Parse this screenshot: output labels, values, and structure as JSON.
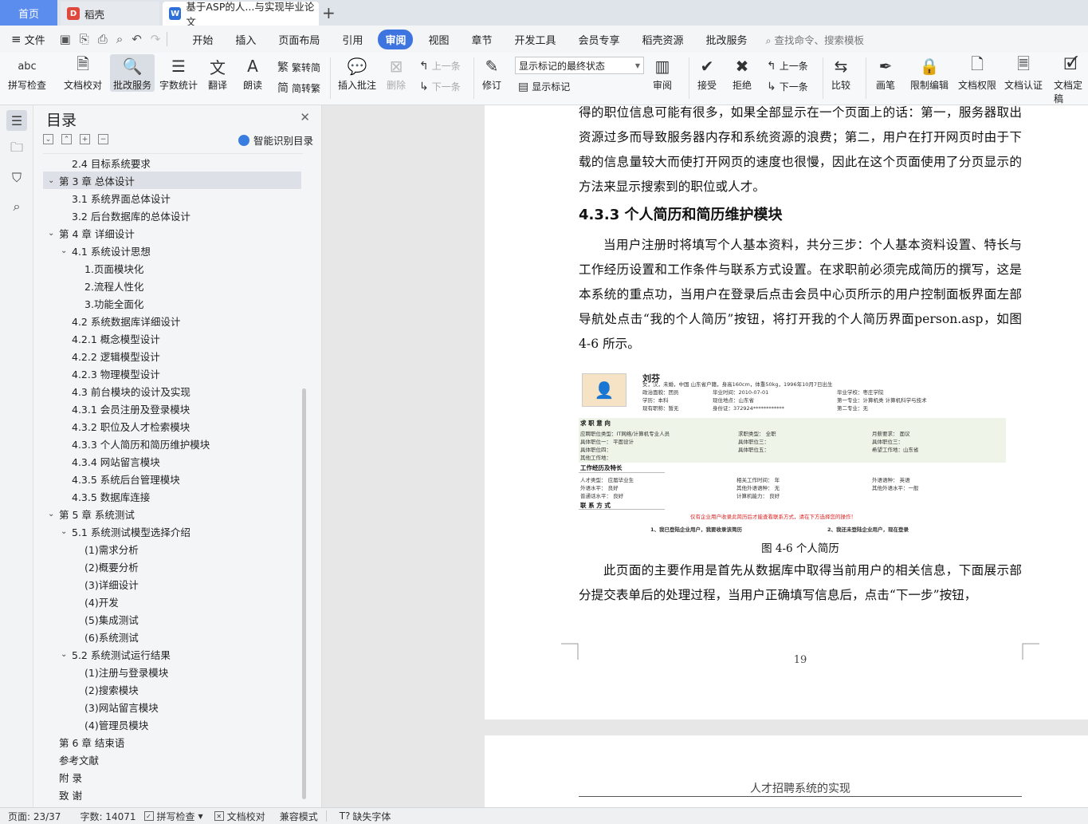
{
  "tabs": {
    "home": "首页",
    "tab1": "稻壳",
    "tab2": "基于ASP的人...与实现毕业论文"
  },
  "menu": {
    "file": "文件",
    "items": [
      "开始",
      "插入",
      "页面布局",
      "引用",
      "审阅",
      "视图",
      "章节",
      "开发工具",
      "会员专享",
      "稻壳资源",
      "批改服务"
    ],
    "active": "审阅",
    "search": "查找命令、搜索模板"
  },
  "ribbon": {
    "spell_check": "拼写检查",
    "doc_check": "文档校对",
    "review_service": "批改服务",
    "word_count": "字数统计",
    "translate": "翻译",
    "read_aloud": "朗读",
    "trad_to_simp": "繁转简",
    "simp_to_trad": "简转繁",
    "insert_comment": "插入批注",
    "delete": "删除",
    "prev": "上一条",
    "next": "下一条",
    "revise": "修订",
    "markup_select": "显示标记的最终状态",
    "show_markup": "显示标记",
    "review": "审阅",
    "accept": "接受",
    "reject": "拒绝",
    "prev2": "上一条",
    "next2": "下一条",
    "compare": "比较",
    "pen": "画笔",
    "restrict_edit": "限制编辑",
    "doc_permission": "文档权限",
    "doc_auth": "文档认证",
    "doc_final": "文档定稿"
  },
  "toc": {
    "title": "目录",
    "smart": "智能识别目录",
    "items": [
      {
        "text": "2.4 目标系统要求",
        "level": 2
      },
      {
        "text": "第 3 章  总体设计",
        "level": 1,
        "open": true,
        "selected": true
      },
      {
        "text": "3.1 系统界面总体设计",
        "level": 2
      },
      {
        "text": "3.2  后台数据库的总体设计",
        "level": 2
      },
      {
        "text": "第 4 章  详细设计",
        "level": 1,
        "open": true
      },
      {
        "text": "4.1 系统设计思想",
        "level": 2,
        "open": true
      },
      {
        "text": "1.页面模块化",
        "level": 3
      },
      {
        "text": "2.流程人性化",
        "level": 3
      },
      {
        "text": "3.功能全面化",
        "level": 3
      },
      {
        "text": "4.2 系统数据库详细设计",
        "level": 2
      },
      {
        "text": "4.2.1 概念模型设计",
        "level": 2
      },
      {
        "text": "4.2.2 逻辑模型设计",
        "level": 2
      },
      {
        "text": "4.2.3 物理模型设计",
        "level": 2
      },
      {
        "text": "4.3 前台模块的设计及实现",
        "level": 2
      },
      {
        "text": "4.3.1 会员注册及登录模块",
        "level": 2
      },
      {
        "text": "4.3.2 职位及人才检索模块",
        "level": 2
      },
      {
        "text": "4.3.3 个人简历和简历维护模块",
        "level": 2
      },
      {
        "text": "4.3.4 网站留言模块",
        "level": 2
      },
      {
        "text": "4.3.5 系统后台管理模块",
        "level": 2
      },
      {
        "text": "4.3.5 数据库连接",
        "level": 2
      },
      {
        "text": "第 5 章  系统测试",
        "level": 1,
        "open": true
      },
      {
        "text": "5.1 系统测试模型选择介绍",
        "level": 2,
        "open": true
      },
      {
        "text": "(1)需求分析",
        "level": 3
      },
      {
        "text": "(2)概要分析",
        "level": 3
      },
      {
        "text": "(3)详细设计",
        "level": 3
      },
      {
        "text": "(4)开发",
        "level": 3
      },
      {
        "text": "(5)集成测试",
        "level": 3
      },
      {
        "text": "(6)系统测试",
        "level": 3
      },
      {
        "text": "5.2 系统测试运行结果",
        "level": 2,
        "open": true
      },
      {
        "text": "(1)注册与登录模块",
        "level": 3
      },
      {
        "text": "(2)搜索模块",
        "level": 3
      },
      {
        "text": "(3)网站留言模块",
        "level": 3
      },
      {
        "text": "(4)管理员模块",
        "level": 3
      },
      {
        "text": "第 6 章 结束语",
        "level": 1
      },
      {
        "text": "参考文献",
        "level": 1
      },
      {
        "text": "附  录",
        "level": 1
      },
      {
        "text": "致  谢",
        "level": 1
      }
    ]
  },
  "document": {
    "para1": "得的职位信息可能有很多，如果全部显示在一个页面上的话：第一，服务器取出资源过多而导致服务器内存和系统资源的浪费；第二，用户在打开网页时由于下载的信息量较大而使打开网页的速度也很慢，因此在这个页面使用了分页显示的方法来显示搜索到的职位或人才。",
    "heading": "4.3.3 个人简历和简历维护模块",
    "para2": "当用户注册时将填写个人基本资料，共分三步：个人基本资料设置、特长与工作经历设置和工作条件与联系方式设置。在求职前必须完成简历的撰写，这是本系统的重点功，当用户在登录后点击会员中心页所示的用户控制面板界面左部导航处点击“我的个人简历”按钮，将打开我的个人简历界面person.asp，如图 4-6 所示。",
    "caption": "图 4-6 个人简历",
    "para3": "此页面的主要作用是首先从数据库中取得当前用户的相关信息，下面展示部分提交表单后的处理过程，当用户正确填写信息后，点击“下一步”按钮，",
    "page_number": "19",
    "page2_header": "人才招聘系统的实现"
  },
  "figure": {
    "name": "刘芬",
    "line1": "女，汉，未婚，中国 山东省户籍，身高160cm，体重50kg，1996年10月7日出生",
    "r2a": "政治面貌：团员",
    "r2b": "毕业时间：2010-07-01",
    "r2c": "毕业学校：枣庄学院",
    "r3a": "学历：本科",
    "r3b": "现住地点：山东省",
    "r3c": "第一专业：计算机类 计算机科学与技术",
    "r4a": "现有职称：暂无",
    "r4b": "身份证：372924************",
    "r4c": "第二专业：无",
    "sec1": "求 职 意 向",
    "j1a": "应聘职位类型：IT网络/计算机专业人员",
    "j1b": "求职类型：   全职",
    "j1c": "月薪要求：   面议",
    "j2a": "具体职位一：   平面设计",
    "j2b": "具体职位三：",
    "j2c": "具体职位三：",
    "j3a": "具体职位四：",
    "j3b": "具体职位五：",
    "j3c": "希望工作地：山东省",
    "j4a": "其他工作地：",
    "sec2": "工作经历及特长",
    "w1a": "人才类型：   应届毕业生",
    "w1b": "相关工作时间：   年",
    "w1c": "外语语种：     英语",
    "w2a": "外语水平：     良好",
    "w2b": "其他外语语种：   无",
    "w2c": "其他外语水平：一般",
    "w3a": "普通话水平：   良好",
    "w3b": "计算机能力：     良好",
    "sec3": "联 系 方 式",
    "red": "仅有企业用户收录此简历后才能查看联系方式，请在下方选择您的操作！",
    "opt1": "1、我已登陆企业用户，我要收录该简历",
    "opt2": "2、我还未登陆企业用户，现在登录"
  },
  "status": {
    "page": "页面: 23/37",
    "words": "字数: 14071",
    "spell": "拼写检查",
    "doc_check": "文档校对",
    "compat": "兼容模式",
    "missing_font": "缺失字体"
  },
  "colors": {
    "accent": "#3d74e0",
    "home_tab": "#5b8def"
  }
}
